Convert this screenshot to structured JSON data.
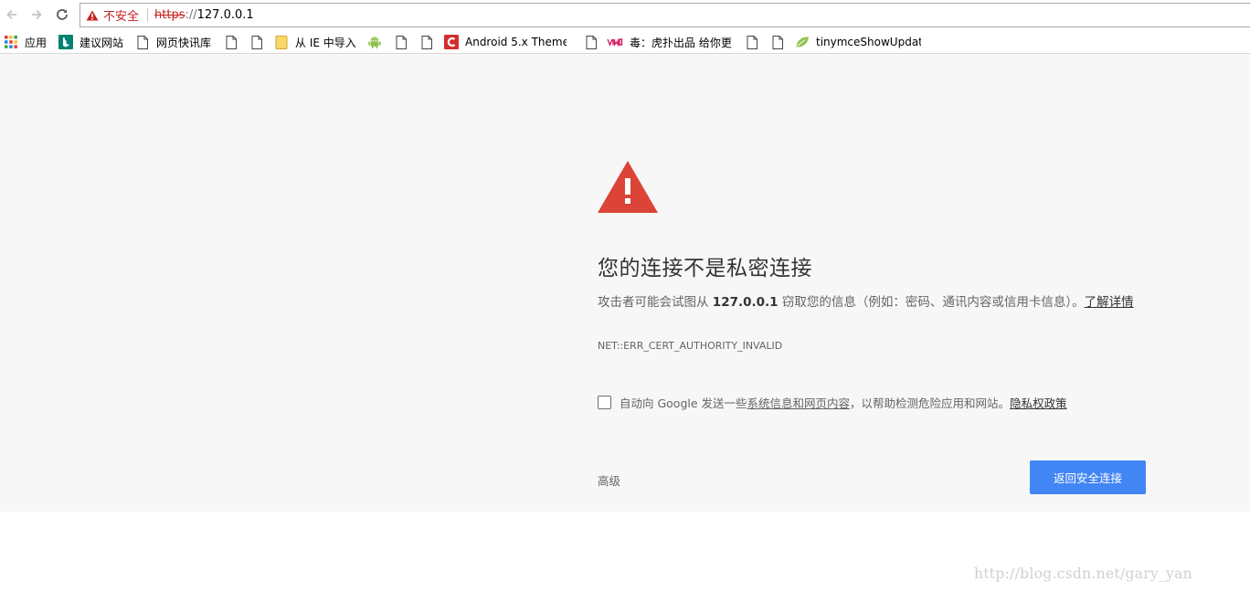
{
  "toolbar": {
    "security_label": "不安全",
    "url_scheme": "https",
    "url_separator": "://",
    "url_host": "127.0.0.1"
  },
  "bookmarks": [
    {
      "label": "应用",
      "icon": "apps-grid-icon"
    },
    {
      "label": "建议网站",
      "icon": "bing-icon"
    },
    {
      "label": "网页快讯库",
      "icon": "page-icon"
    },
    {
      "label": "",
      "icon": "page-icon"
    },
    {
      "label": "",
      "icon": "page-icon"
    },
    {
      "label": "从 IE 中导入",
      "icon": "folder-icon"
    },
    {
      "label": "",
      "icon": "android-icon"
    },
    {
      "label": "",
      "icon": "page-icon"
    },
    {
      "label": "",
      "icon": "page-icon"
    },
    {
      "label": "Android 5.x Theme",
      "icon": "c-red-icon"
    },
    {
      "label": "",
      "icon": "page-icon"
    },
    {
      "label": "毒：虎扑出品 给你更",
      "icon": "dupu-icon"
    },
    {
      "label": "",
      "icon": "page-icon"
    },
    {
      "label": "",
      "icon": "page-icon"
    },
    {
      "label": "tinymceShowUpdat",
      "icon": "leaf-icon"
    }
  ],
  "interstitial": {
    "heading": "您的连接不是私密连接",
    "para_prefix": "攻击者可能会试图从 ",
    "para_host": "127.0.0.1",
    "para_suffix": " 窃取您的信息（例如：密码、通讯内容或信用卡信息）。",
    "learn_more": "了解详情",
    "error_code": "NET::ERR_CERT_AUTHORITY_INVALID",
    "optin_prefix": "自动向 Google 发送一些",
    "optin_link": "系统信息和网页内容",
    "optin_suffix": "，以帮助检测危险应用和网站。",
    "privacy_link": "隐私权政策",
    "advanced": "高级",
    "back_button": "返回安全连接"
  },
  "watermark": "http://blog.csdn.net/gary_yan",
  "colors": {
    "danger": "#db4437",
    "primary_button": "#4285f4",
    "page_background": "#f7f7f7"
  }
}
